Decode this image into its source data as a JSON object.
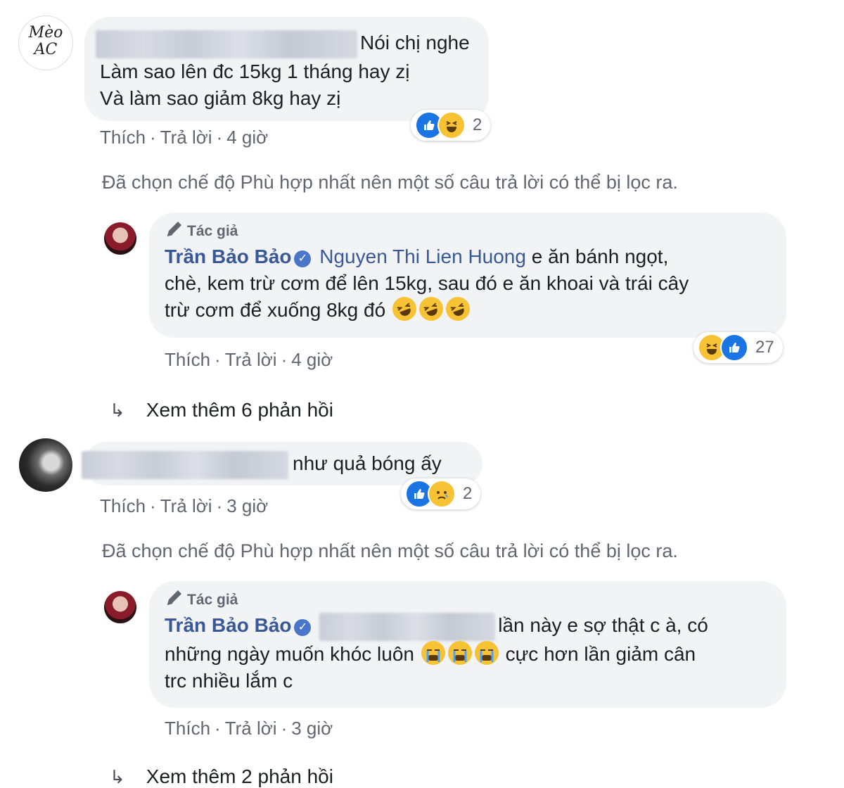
{
  "avatars": {
    "meo_ac_label_line1": "Mèo",
    "meo_ac_label_line2": "AC"
  },
  "comments": [
    {
      "text_line1_tail": "Nói chị nghe",
      "text_line2": "Làm sao lên đc 15kg 1 tháng hay zị",
      "text_line3": "Và làm sao giảm 8kg hay zị",
      "meta": {
        "like": "Thích",
        "reply": "Trả lời",
        "time": "4 giờ"
      },
      "reactions": {
        "types": [
          "like-icon",
          "haha-icon"
        ],
        "count": "2"
      }
    },
    {
      "text_tail": "như quả bóng ấy",
      "meta": {
        "like": "Thích",
        "reply": "Trả lời",
        "time": "3 giờ"
      },
      "reactions": {
        "types": [
          "like-icon",
          "sad-icon"
        ],
        "count": "2"
      }
    }
  ],
  "filter_note": "Đã chọn chế độ Phù hợp nhất nên một số câu trả lời có thể bị lọc ra.",
  "replies": [
    {
      "author_tag": "Tác giả",
      "author_name": "Trần Bảo Bảo",
      "mention": "Nguyen Thi Lien Huong",
      "text_line1": "e ăn bánh ngọt,",
      "text_line2": "chè, kem trừ cơm để lên 15kg, sau đó e ăn khoai và trái cây",
      "text_line3": "trừ cơm để xuống 8kg đó",
      "meta": {
        "like": "Thích",
        "reply": "Trả lời",
        "time": "4 giờ"
      },
      "reactions": {
        "types": [
          "haha-icon",
          "like-icon"
        ],
        "count": "27"
      }
    },
    {
      "author_tag": "Tác giả",
      "author_name": "Trần Bảo Bảo",
      "text_line1_tail": "lần này e sợ thật c à, có",
      "text_line2_head": "những ngày muốn khóc luôn",
      "text_line2_tail": "cực hơn lần giảm cân",
      "text_line3": "trc nhiều lắm c",
      "meta": {
        "like": "Thích",
        "reply": "Trả lời",
        "time": "3 giờ"
      }
    }
  ],
  "see_more": [
    {
      "label": "Xem thêm 6 phản hồi"
    },
    {
      "label": "Xem thêm 2 phản hồi"
    }
  ],
  "colors": {
    "bubble": "#f2f3f5",
    "link": "#385898",
    "meta": "#606770",
    "like": "#1b74e4",
    "emoji": "#f7c334"
  }
}
